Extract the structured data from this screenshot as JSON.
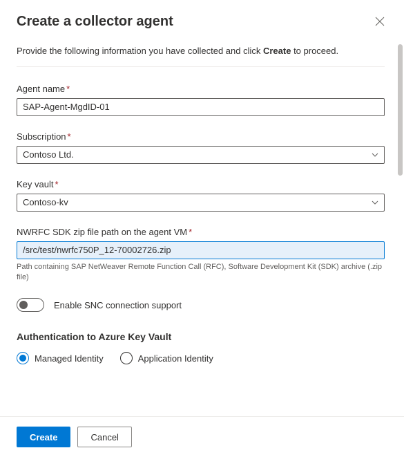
{
  "title": "Create a collector agent",
  "intro_prefix": "Provide the following information you have collected and click ",
  "intro_bold": "Create",
  "intro_suffix": " to proceed.",
  "fields": {
    "agent_name": {
      "label": "Agent name",
      "value": "SAP-Agent-MgdID-01"
    },
    "subscription": {
      "label": "Subscription",
      "value": "Contoso Ltd."
    },
    "key_vault": {
      "label": "Key vault",
      "value": "Contoso-kv"
    },
    "sdk_path": {
      "label": "NWRFC SDK zip file path on the agent VM",
      "value": "/src/test/nwrfc750P_12-70002726.zip",
      "helper": "Path containing SAP NetWeaver Remote Function Call (RFC), Software Development Kit (SDK) archive (.zip file)"
    }
  },
  "toggle": {
    "label": "Enable SNC connection support"
  },
  "auth_section": {
    "heading": "Authentication to Azure Key Vault",
    "options": {
      "managed": "Managed Identity",
      "application": "Application Identity"
    }
  },
  "footer": {
    "create": "Create",
    "cancel": "Cancel"
  }
}
